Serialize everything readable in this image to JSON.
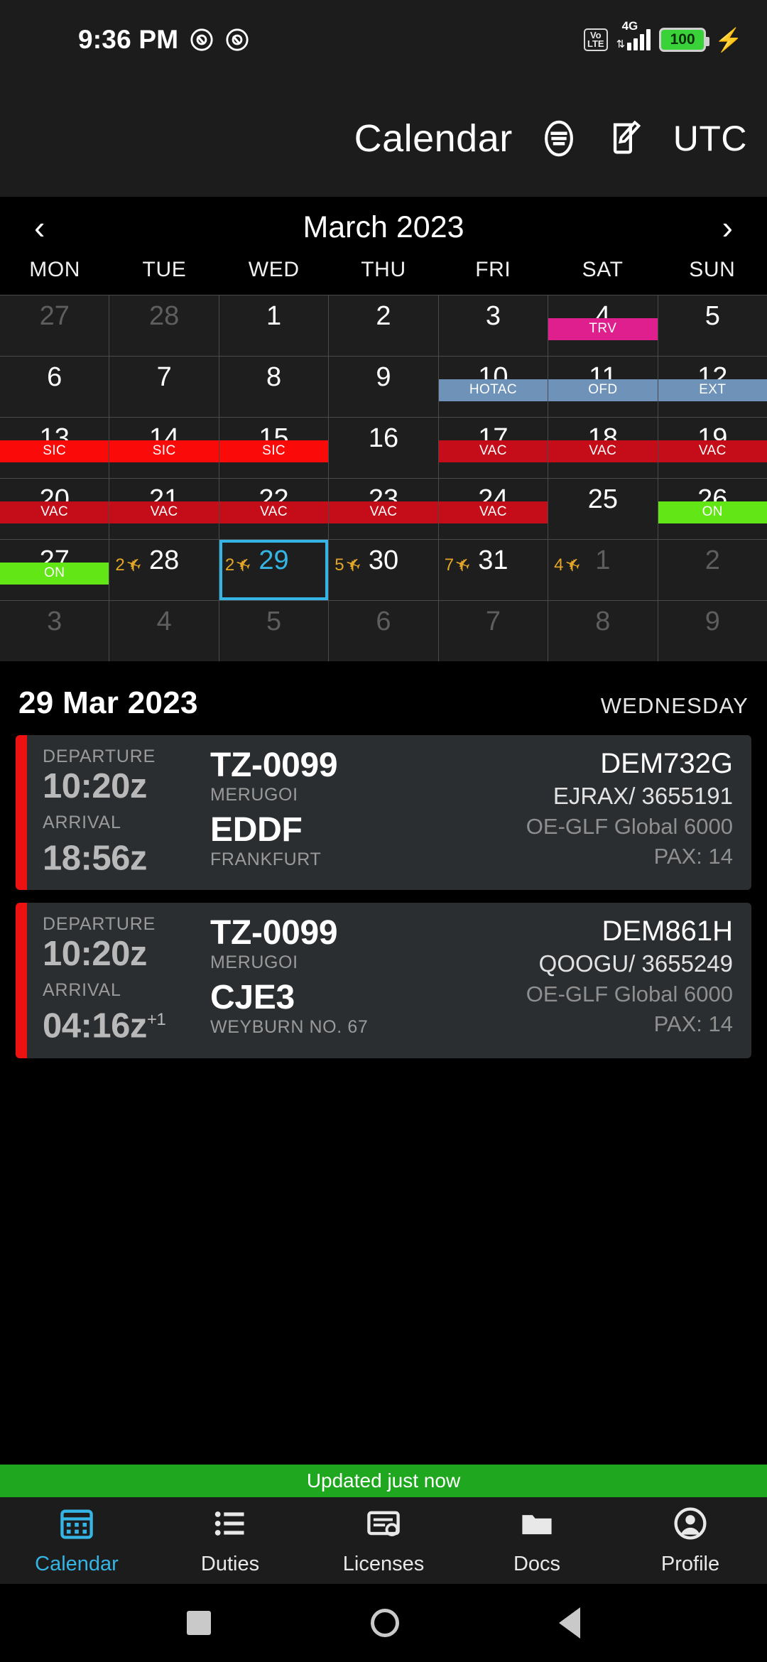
{
  "status_bar": {
    "time": "9:36 PM",
    "mute_icon_1": "mute-icon",
    "mute_icon_2": "mute-icon",
    "volte": "VoLTE",
    "network": "4G",
    "battery_pct": "100",
    "charging_icon": "bolt-icon"
  },
  "header": {
    "title": "Calendar",
    "filter_icon": "filter-icon",
    "compose_icon": "compose-icon",
    "timezone": "UTC"
  },
  "month_nav": {
    "prev": "‹",
    "title": "March 2023",
    "next": "›"
  },
  "weekdays": [
    "MON",
    "TUE",
    "WED",
    "THU",
    "FRI",
    "SAT",
    "SUN"
  ],
  "colors": {
    "trv": "#e01f8f",
    "blue": "#6f92b8",
    "sic": "#fb0a0a",
    "vac": "#c40d18",
    "on": "#63e616",
    "selected": "#35b5e5",
    "flight": "#e3a626",
    "card_stripe": "#ee1111",
    "updated_bar": "#1fa81f"
  },
  "calendar": [
    [
      {
        "day": "27",
        "muted": true
      },
      {
        "day": "28",
        "muted": true
      },
      {
        "day": "1"
      },
      {
        "day": "2"
      },
      {
        "day": "3"
      },
      {
        "day": "4",
        "badge": "TRV",
        "badge_type": "trv"
      },
      {
        "day": "5"
      }
    ],
    [
      {
        "day": "6"
      },
      {
        "day": "7"
      },
      {
        "day": "8"
      },
      {
        "day": "9"
      },
      {
        "day": "10",
        "badge": "HOTAC",
        "badge_type": "blue"
      },
      {
        "day": "11",
        "badge": "OFD",
        "badge_type": "blue"
      },
      {
        "day": "12",
        "badge": "EXT",
        "badge_type": "blue"
      }
    ],
    [
      {
        "day": "13",
        "badge": "SIC",
        "badge_type": "sic"
      },
      {
        "day": "14",
        "badge": "SIC",
        "badge_type": "sic"
      },
      {
        "day": "15",
        "badge": "SIC",
        "badge_type": "sic"
      },
      {
        "day": "16"
      },
      {
        "day": "17",
        "badge": "VAC",
        "badge_type": "vac"
      },
      {
        "day": "18",
        "badge": "VAC",
        "badge_type": "vac"
      },
      {
        "day": "19",
        "badge": "VAC",
        "badge_type": "vac"
      }
    ],
    [
      {
        "day": "20",
        "badge": "VAC",
        "badge_type": "vac"
      },
      {
        "day": "21",
        "badge": "VAC",
        "badge_type": "vac"
      },
      {
        "day": "22",
        "badge": "VAC",
        "badge_type": "vac"
      },
      {
        "day": "23",
        "badge": "VAC",
        "badge_type": "vac"
      },
      {
        "day": "24",
        "badge": "VAC",
        "badge_type": "vac"
      },
      {
        "day": "25"
      },
      {
        "day": "26",
        "badge": "ON",
        "badge_type": "on"
      }
    ],
    [
      {
        "day": "27",
        "badge": "ON",
        "badge_type": "on"
      },
      {
        "day": "28",
        "flights": "2"
      },
      {
        "day": "29",
        "flights": "2",
        "selected": true
      },
      {
        "day": "30",
        "flights": "5"
      },
      {
        "day": "31",
        "flights": "7"
      },
      {
        "day": "1",
        "muted": true,
        "flights": "4"
      },
      {
        "day": "2",
        "muted": true
      }
    ],
    [
      {
        "day": "3",
        "muted": true
      },
      {
        "day": "4",
        "muted": true
      },
      {
        "day": "5",
        "muted": true
      },
      {
        "day": "6",
        "muted": true
      },
      {
        "day": "7",
        "muted": true
      },
      {
        "day": "8",
        "muted": true
      },
      {
        "day": "9",
        "muted": true
      }
    ]
  ],
  "day_detail": {
    "date": "29 Mar 2023",
    "weekday": "WEDNESDAY"
  },
  "flights": [
    {
      "departure_label": "DEPARTURE",
      "departure_time": "10:20z",
      "arrival_label": "ARRIVAL",
      "arrival_time": "18:56z",
      "arrival_plus": "",
      "dep_code": "TZ-0099",
      "dep_place": "MERUGOI",
      "arr_code": "EDDF",
      "arr_place": "FRANKFURT",
      "flight_id": "DEM732G",
      "crew": "EJRAX/ 3655191",
      "aircraft": "OE-GLF Global 6000",
      "pax": "PAX: 14"
    },
    {
      "departure_label": "DEPARTURE",
      "departure_time": "10:20z",
      "arrival_label": "ARRIVAL",
      "arrival_time": "04:16z",
      "arrival_plus": "+1",
      "dep_code": "TZ-0099",
      "dep_place": "MERUGOI",
      "arr_code": "CJE3",
      "arr_place": "WEYBURN NO. 67",
      "flight_id": "DEM861H",
      "crew": "QOOGU/ 3655249",
      "aircraft": "OE-GLF Global 6000",
      "pax": "PAX: 14"
    }
  ],
  "updated_bar": {
    "text": "Updated just now"
  },
  "bottom_nav": [
    {
      "label": "Calendar",
      "icon": "calendar-icon",
      "active": true
    },
    {
      "label": "Duties",
      "icon": "list-icon",
      "active": false
    },
    {
      "label": "Licenses",
      "icon": "license-card-icon",
      "active": false
    },
    {
      "label": "Docs",
      "icon": "folder-icon",
      "active": false
    },
    {
      "label": "Profile",
      "icon": "person-icon",
      "active": false
    }
  ],
  "android_nav": {
    "recents": "square-icon",
    "home": "circle-icon",
    "back": "triangle-back-icon"
  }
}
